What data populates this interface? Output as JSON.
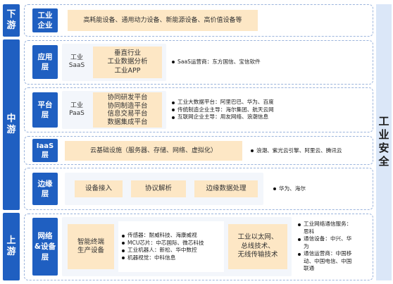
{
  "stages": {
    "downstream": "下\n游",
    "midstream": "中\n游",
    "upstream": "上\n游"
  },
  "safety": "工业安全",
  "downstream_row": {
    "label": "工业\n企业",
    "content": "高耗能设备、通用动力设备、新能源设备、高价值设备等"
  },
  "app_layer": {
    "label": "应用\n层",
    "type": "工业\nSaaS",
    "items": "垂直行业\n工业数据分析\n工业APP",
    "vendors": [
      "SaaS运营商：东方国信、宝信软件"
    ]
  },
  "platform_layer": {
    "label": "平台\n层",
    "type": "工业\nPaaS",
    "items": "协同研发平台\n协同制造平台\n信息交易平台\n数据集成平台",
    "vendors": [
      "工业大数据平台：阿里巴巴、华为、百度",
      "传统制造企业主导：海尔集团、航天云网",
      "互联网企业主导：用友网络、浪潮信息"
    ]
  },
  "iaas_layer": {
    "label": "IaaS\n层",
    "content": "云基础设施（服务器、存储、网络、虚拟化）",
    "vendors": [
      "浪潮、紫光云引擎、阿里云、腾讯云"
    ]
  },
  "edge_layer": {
    "label": "边缘\n层",
    "items": [
      "设备接入",
      "协议解析",
      "边缘数据处理"
    ],
    "vendors": [
      "华为、海尔"
    ]
  },
  "network_layer": {
    "label": "网络\n&设备\n层",
    "terminal": "智能终端\n生产设备",
    "components": [
      "传感器：耐威科技、海康威视",
      "MCU芯片：中芯国际、微芯科技",
      "工业机器人：新松、华中数控",
      "机器视觉：中科信息"
    ],
    "network_tech": "工业以太网、\n总线技术、\n无线传输技术",
    "services": [
      "工业网络通信服务：\n思科",
      "通信设备：中兴、华\n为",
      "通信运营商：中国移\n动、中国电信、中国\n联通"
    ]
  }
}
